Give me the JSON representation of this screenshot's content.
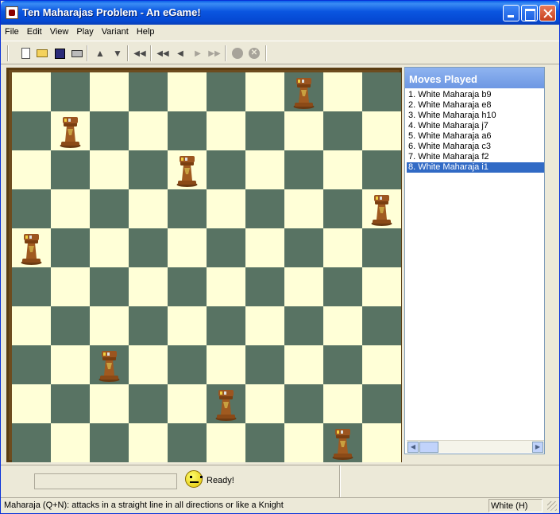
{
  "window": {
    "title": "Ten Maharajas Problem - An eGame!"
  },
  "menu": [
    "File",
    "Edit",
    "View",
    "Play",
    "Variant",
    "Help"
  ],
  "toolbar": [
    {
      "name": "new-game-icon",
      "glyph": "page"
    },
    {
      "name": "open-icon",
      "glyph": "folder"
    },
    {
      "name": "save-icon",
      "glyph": "disk"
    },
    {
      "name": "print-icon",
      "glyph": "printer"
    },
    {
      "name": "up-arrow-icon",
      "glyph": "▲"
    },
    {
      "name": "down-arrow-icon",
      "glyph": "▼"
    },
    {
      "name": "rewind-all-icon",
      "glyph": "◀◀"
    },
    {
      "name": "first-move-icon",
      "glyph": "|◀◀"
    },
    {
      "name": "previous-move-icon",
      "glyph": "◀"
    },
    {
      "name": "next-move-icon",
      "glyph": "▶"
    },
    {
      "name": "last-move-icon",
      "glyph": "▶▶|"
    },
    {
      "name": "stop-icon",
      "glyph": "circle"
    },
    {
      "name": "cancel-icon",
      "glyph": "x"
    }
  ],
  "board": {
    "files": [
      "a",
      "b",
      "c",
      "d",
      "e",
      "f",
      "g",
      "h",
      "i",
      "j"
    ],
    "rank_count": 10,
    "light_color": "#ffffd7",
    "dark_color": "#587363",
    "pieces": [
      {
        "square": "b9",
        "type": "maharaja",
        "color": "white"
      },
      {
        "square": "e8",
        "type": "maharaja",
        "color": "white"
      },
      {
        "square": "h10",
        "type": "maharaja",
        "color": "white"
      },
      {
        "square": "j7",
        "type": "maharaja",
        "color": "white"
      },
      {
        "square": "a6",
        "type": "maharaja",
        "color": "white"
      },
      {
        "square": "c3",
        "type": "maharaja",
        "color": "white"
      },
      {
        "square": "f2",
        "type": "maharaja",
        "color": "white"
      },
      {
        "square": "i1",
        "type": "maharaja",
        "color": "white"
      }
    ]
  },
  "moves_panel": {
    "title": "Moves Played",
    "moves": [
      "1. White Maharaja b9",
      "2. White Maharaja e8",
      "3. White Maharaja h10",
      "4. White Maharaja j7",
      "5. White Maharaja a6",
      "6. White Maharaja c3",
      "7. White Maharaja f2",
      "8. White Maharaja i1"
    ],
    "selected_index": 7
  },
  "status": {
    "ready": "Ready!",
    "hint": "Maharaja (Q+N): attacks in a straight line in all directions or like a Knight",
    "player": "White (H)"
  },
  "colors": {
    "accent": "#316ac5",
    "board_frame": "#6d4c1f"
  }
}
